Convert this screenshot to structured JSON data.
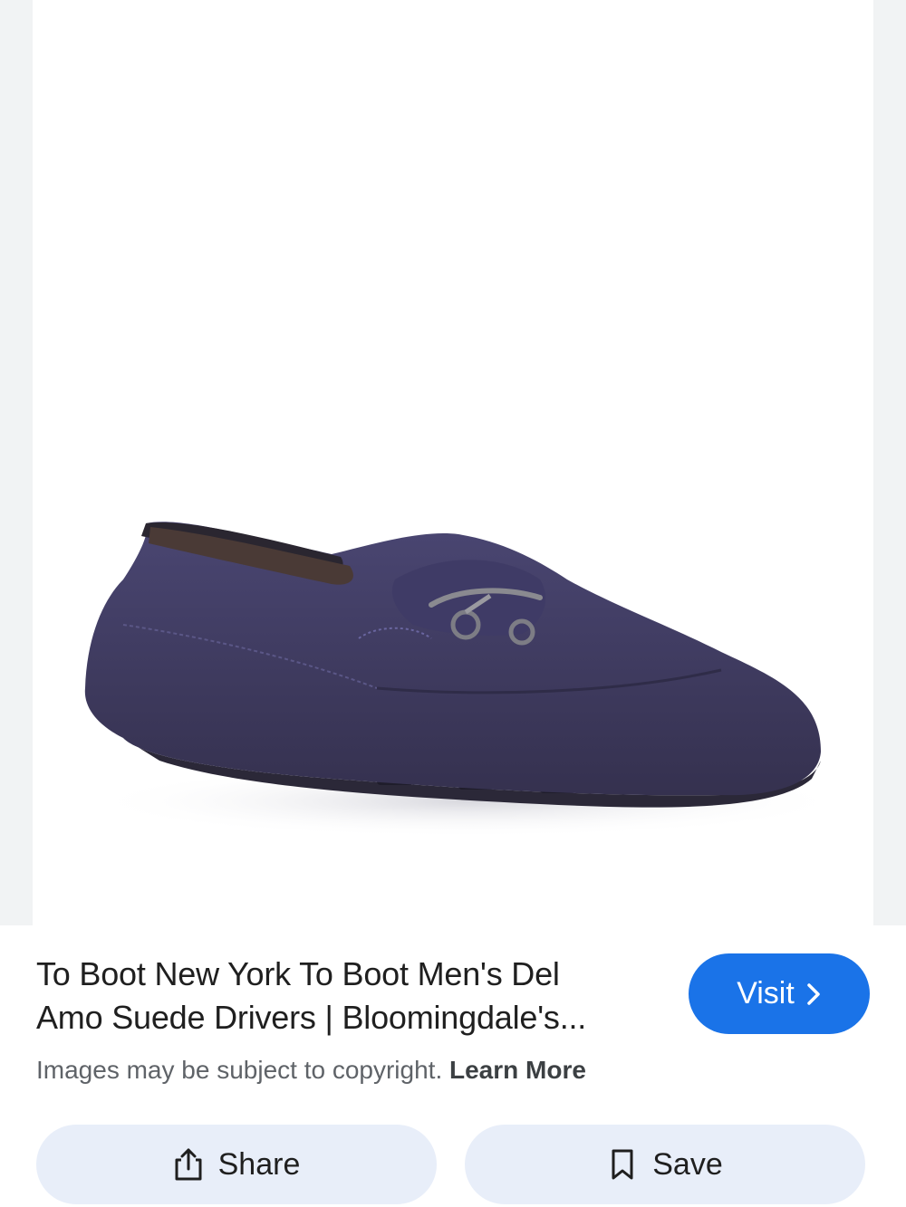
{
  "image": {
    "alt": "To Boot New York Men's Del Amo Suede Drivers",
    "icon": "product-image",
    "shoe_color": "#3e3a63",
    "background_color": "#ffffff"
  },
  "result": {
    "title": "To Boot New York To Boot Men's Del Amo Suede Drivers | Bloomingdale's...",
    "title_line1": "To Boot New York To Boot Men's Del",
    "title_line2": "Amo Suede Drivers | Bloomingdale's...",
    "visit_label": "Visit",
    "visit_icon": "chevron-right-icon",
    "copyright_text": "Images may be subject to copyright.",
    "learn_more_label": "Learn More"
  },
  "actions": {
    "share_label": "Share",
    "share_icon": "share-icon",
    "save_label": "Save",
    "save_icon": "bookmark-icon"
  },
  "colors": {
    "accent": "#1a73e8",
    "action_bg": "#e8eef9",
    "secondary_text": "#5f6368"
  }
}
